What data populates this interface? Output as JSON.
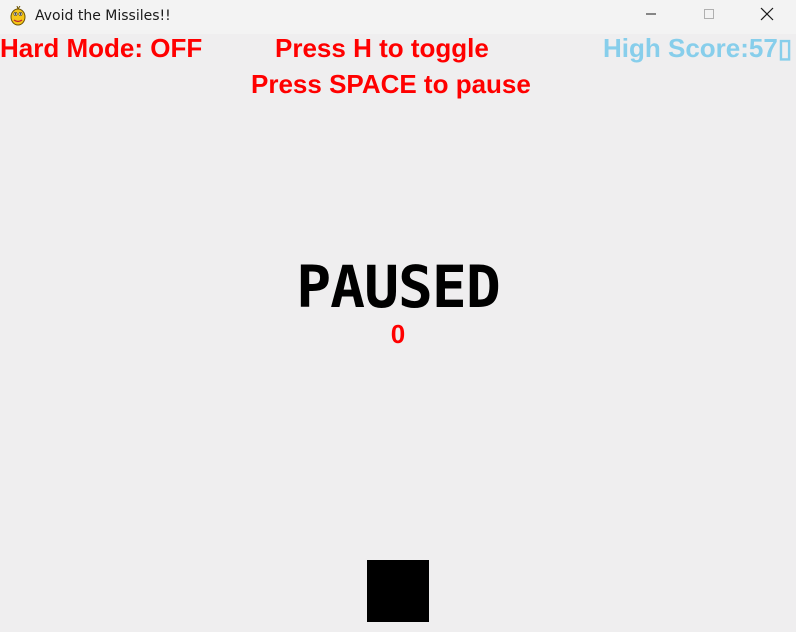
{
  "window": {
    "title": "Avoid the Missiles!!",
    "icon": "pygame-snake-icon",
    "controls": {
      "minimize_icon": "minimize-icon",
      "maximize_icon": "maximize-icon",
      "close_icon": "close-icon"
    }
  },
  "hud": {
    "hard_mode": "Hard Mode: OFF",
    "toggle_hint": "Press H to toggle",
    "high_score": "High Score:57▯",
    "pause_hint": "Press SPACE to pause"
  },
  "game": {
    "status": "PAUSED",
    "score": "0"
  },
  "colors": {
    "hud_red": "#ff0000",
    "high_score_blue": "#87ceeb",
    "paused_text": "#000000",
    "player": "#000000",
    "background": "#efeeef"
  }
}
